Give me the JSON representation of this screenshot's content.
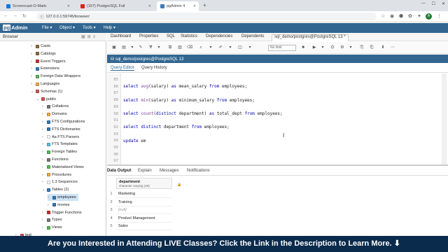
{
  "browser": {
    "tabs": [
      {
        "label": "Screencast-O-Matic",
        "fav_color": "#1a73e8",
        "active": false
      },
      {
        "label": "(167) PostgreSQL Full",
        "fav_color": "#e02020",
        "active": false
      },
      {
        "label": "pgAdmin 4",
        "fav_color": "#3f7ab8",
        "active": true
      }
    ],
    "url": "127.0.0.1:59745/browser/",
    "avatar_letter": "A"
  },
  "app": {
    "logo_pg": "pg",
    "logo_text": "Admin",
    "menu": [
      "File",
      "Object",
      "Tools",
      "Help"
    ]
  },
  "browser_panel": {
    "title": "Browser",
    "tree": [
      {
        "caret": "›",
        "label": "Casts",
        "indent": 0,
        "color": "#8a6d3b"
      },
      {
        "caret": "›",
        "label": "Catalogs",
        "indent": 0,
        "color": "#8a6d3b"
      },
      {
        "caret": "›",
        "label": "Event Triggers",
        "indent": 0,
        "color": "#c9302c"
      },
      {
        "caret": "›",
        "label": "Extensions",
        "indent": 0,
        "color": "#337ab7"
      },
      {
        "caret": "›",
        "label": "Foreign Data Wrappers",
        "indent": 0,
        "color": "#5cb85c"
      },
      {
        "caret": "›",
        "label": "Languages",
        "indent": 0,
        "color": "#f0ad4e"
      },
      {
        "caret": "⌄",
        "label": "Schemas (1)",
        "indent": 0,
        "color": "#d9534f"
      },
      {
        "caret": "⌄",
        "label": "public",
        "indent": 1,
        "color": "#d9534f"
      },
      {
        "caret": "›",
        "label": "Collations",
        "indent": 2,
        "color": "#777"
      },
      {
        "caret": "›",
        "label": "Domains",
        "indent": 2,
        "color": "#f0ad4e"
      },
      {
        "caret": "›",
        "label": "FTS Configurations",
        "indent": 2,
        "color": "#337ab7"
      },
      {
        "caret": "›",
        "label": "FTS Dictionaries",
        "indent": 2,
        "color": "#337ab7"
      },
      {
        "caret": "›",
        "label": "Aa FTS Parsers",
        "indent": 2,
        "color": "#fff"
      },
      {
        "caret": "›",
        "label": "FTS Templates",
        "indent": 2,
        "color": "#5bc0de"
      },
      {
        "caret": "›",
        "label": "Foreign Tables",
        "indent": 2,
        "color": "#5cb85c"
      },
      {
        "caret": "›",
        "label": "Functions",
        "indent": 2,
        "color": "#777"
      },
      {
        "caret": "›",
        "label": "Materialized Views",
        "indent": 2,
        "color": "#5cb85c"
      },
      {
        "caret": "›",
        "label": "Procedures",
        "indent": 2,
        "color": "#f0ad4e"
      },
      {
        "caret": "›",
        "label": "1.3 Sequences",
        "indent": 2,
        "color": "#fff"
      },
      {
        "caret": "⌄",
        "label": "Tables (2)",
        "indent": 2,
        "color": "#337ab7"
      },
      {
        "caret": "›",
        "label": "employees",
        "indent": 3,
        "color": "#337ab7",
        "selected": true
      },
      {
        "caret": "›",
        "label": "movies",
        "indent": 3,
        "color": "#337ab7"
      },
      {
        "caret": "›",
        "label": "Trigger Functions",
        "indent": 2,
        "color": "#c9302c"
      },
      {
        "caret": "›",
        "label": "Types",
        "indent": 2,
        "color": "#777"
      },
      {
        "caret": "›",
        "label": "Views",
        "indent": 2,
        "color": "#5cb85c"
      },
      {
        "caret": "›",
        "label": "test",
        "indent": -1,
        "color": "#d9534f"
      }
    ]
  },
  "main_tabs": [
    "Dashboard",
    "Properties",
    "SQL",
    "Statistics",
    "Dependencies",
    "Dependents",
    "sql_demo/postgres@PostgreSQL 13 *"
  ],
  "toolbar": {
    "limit_select": "No limit"
  },
  "connection": "sql_demo/postgres@PostgreSQL 13",
  "sub_tabs": [
    "Query Editor",
    "Query History"
  ],
  "editor": {
    "lines": [
      {
        "n": "85",
        "text": ""
      },
      {
        "n": "86",
        "text": "select avg(salary) as mean_salary from employees;"
      },
      {
        "n": "87",
        "text": ""
      },
      {
        "n": "88",
        "text": "select min(salary) as minimum_salary from employees;"
      },
      {
        "n": "89",
        "text": ""
      },
      {
        "n": "90",
        "text": "select count(distinct department) as total_dept from employees;"
      },
      {
        "n": "91",
        "text": ""
      },
      {
        "n": "92",
        "text": "select distinct department from employees;"
      },
      {
        "n": "93",
        "text": ""
      },
      {
        "n": "94",
        "text": "update em"
      },
      {
        "n": "95",
        "text": ""
      },
      {
        "n": "96",
        "text": ""
      },
      {
        "n": "97",
        "text": ""
      }
    ]
  },
  "output_tabs": [
    "Data Output",
    "Explain",
    "Messages",
    "Notifications"
  ],
  "results": {
    "column": {
      "name": "department",
      "type": "character varying (40)"
    },
    "rows": [
      {
        "n": "1",
        "value": "Marketing"
      },
      {
        "n": "2",
        "value": "Training"
      },
      {
        "n": "3",
        "value": "[null]"
      },
      {
        "n": "4",
        "value": "Product Management"
      },
      {
        "n": "5",
        "value": "Sales"
      }
    ]
  },
  "banner": "Are you Interested in Attending LIVE Classes? Click the Link in the Description to Learn More. ⬇"
}
